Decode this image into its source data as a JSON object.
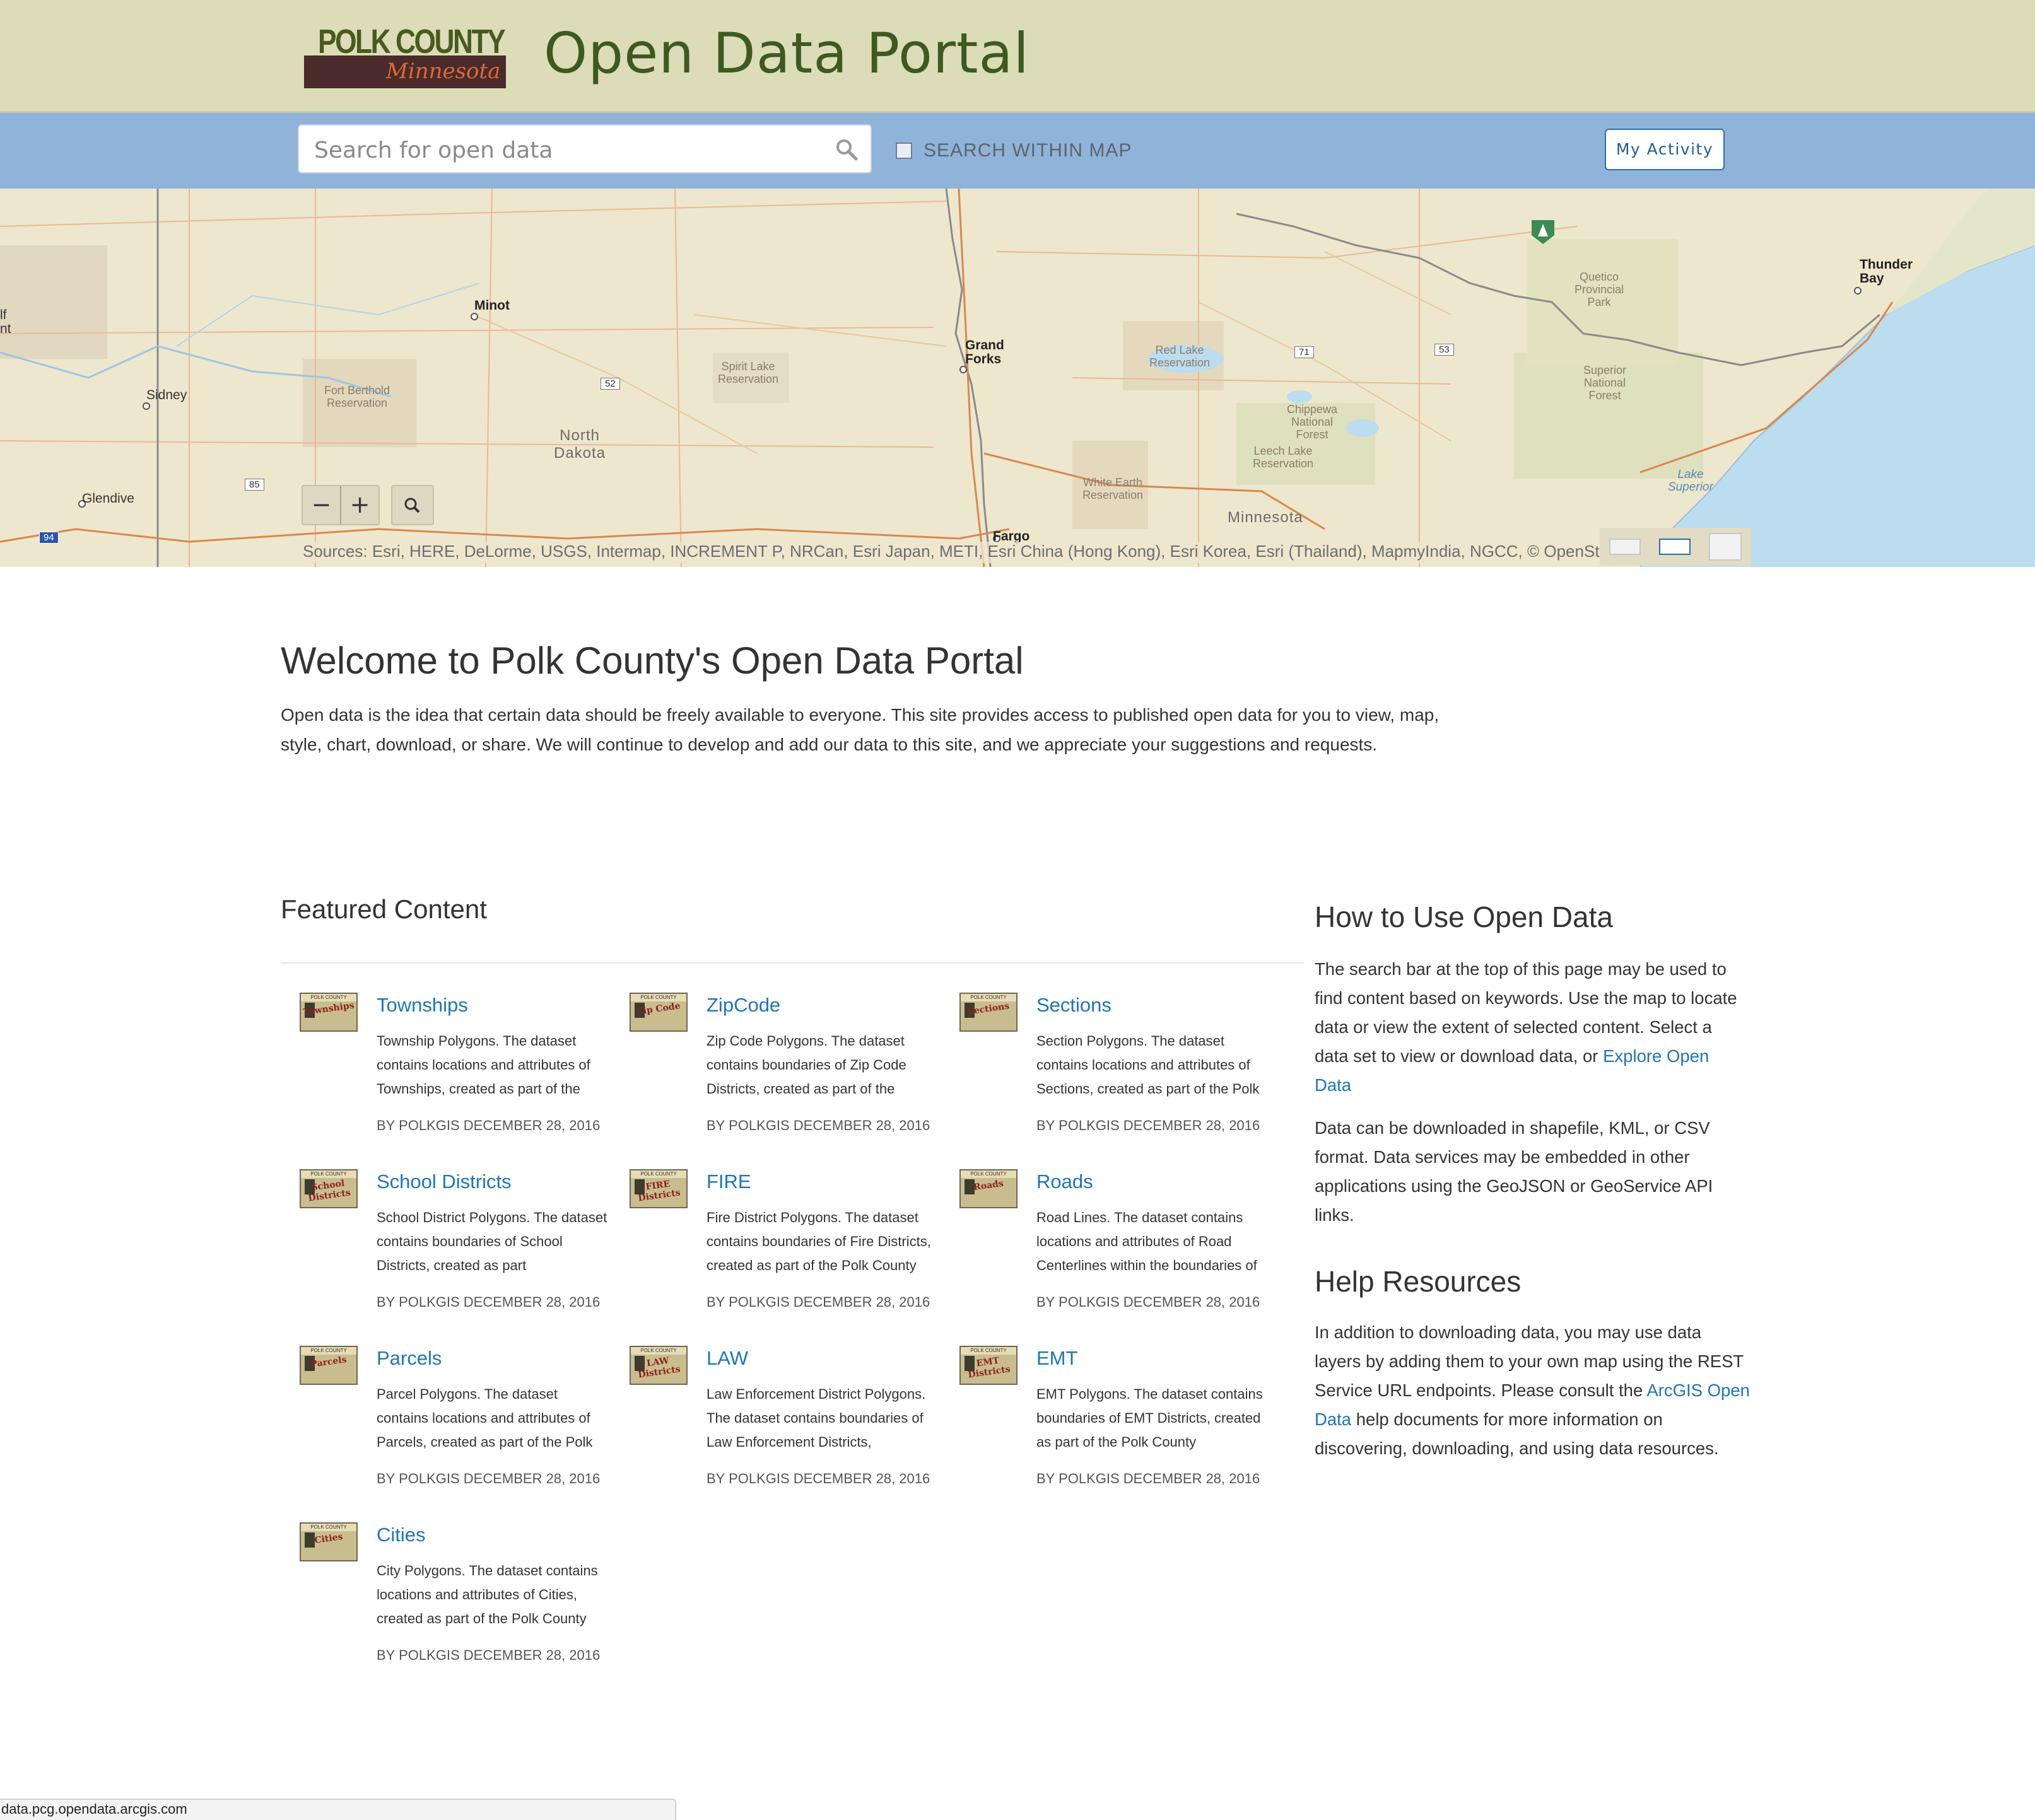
{
  "header": {
    "logo_county": "POLK COUNTY",
    "logo_state": "Minnesota",
    "title": "Open Data Portal"
  },
  "search": {
    "placeholder": "Search for open data",
    "value": "",
    "within_map_label": "SEARCH WITHIN MAP",
    "within_map_checked": false,
    "activity_button": "My Activity"
  },
  "map": {
    "labels": {
      "minot": "Minot",
      "sidney": "Sidney",
      "glendive": "Glendive",
      "grand_forks": "Grand\nForks",
      "fargo": "Fargo",
      "north_dakota": "North\nDakota",
      "minnesota": "Minnesota",
      "thunder_bay": "Thunder\nBay",
      "fort_berthold": "Fort Berthold\nReservation",
      "spirit_lake": "Spirit Lake\nReservation",
      "red_lake": "Red Lake\nReservation",
      "white_earth": "White Earth\nReservation",
      "leech_lake": "Leech Lake\nReservation",
      "chippewa": "Chippewa\nNational\nForest",
      "superior_nf": "Superior\nNational\nForest",
      "quetico": "Quetico\nProvincial\nPark",
      "lake_superior": "Lake\nSuperior",
      "edge_left": "lf\nnt",
      "hwy_52": "52",
      "hwy_85": "85",
      "hwy_71": "71",
      "hwy_53": "53",
      "hwy_94": "94"
    },
    "zoom_out": "−",
    "zoom_in": "+",
    "attribution": "Sources: Esri, HERE, DeLorme, USGS, Intermap, INCREMENT P, NRCan, Esri Japan, METI, Esri China (Hong Kong), Esri Korea, Esri (Thailand), MapmyIndia, NGCC, © OpenStre"
  },
  "welcome": {
    "title": "Welcome to Polk County's Open Data Portal",
    "text": "Open data is the idea that certain data should be freely available to everyone. This site provides access to published open data for you to view, map, style, chart, download, or share. We will continue to develop and add our data to this site, and we appreciate your suggestions and requests."
  },
  "featured": {
    "title": "Featured Content",
    "items": [
      {
        "title": "Townships",
        "thumb": "Townships",
        "desc": "Township Polygons. The dataset contains locations and attributes of Townships, created as part of the",
        "meta": "BY POLKGIS DECEMBER 28, 2016"
      },
      {
        "title": "ZipCode",
        "thumb": "Zip Code",
        "desc": "Zip Code Polygons. The dataset contains boundaries of Zip Code Districts, created as part of the",
        "meta": "BY POLKGIS DECEMBER 28, 2016"
      },
      {
        "title": "Sections",
        "thumb": "Sections",
        "desc": "Section Polygons. The dataset contains locations and attributes of Sections, created as part of the Polk",
        "meta": "BY POLKGIS DECEMBER 28, 2016"
      },
      {
        "title": "School Districts",
        "thumb": "School Districts",
        "desc": "School District Polygons. The dataset contains boundaries of School Districts, created as part",
        "meta": "BY POLKGIS DECEMBER 28, 2016"
      },
      {
        "title": "FIRE",
        "thumb": "FIRE Districts",
        "desc": "Fire District Polygons. The dataset contains boundaries of Fire Districts, created as part of the Polk County",
        "meta": "BY POLKGIS DECEMBER 28, 2016"
      },
      {
        "title": "Roads",
        "thumb": "Roads",
        "desc": "Road Lines. The dataset contains locations and attributes of Road Centerlines within the boundaries of",
        "meta": "BY POLKGIS DECEMBER 28, 2016"
      },
      {
        "title": "Parcels",
        "thumb": "Parcels",
        "desc": "Parcel Polygons. The dataset contains locations and attributes of Parcels, created as part of the Polk",
        "meta": "BY POLKGIS DECEMBER 28, 2016"
      },
      {
        "title": "LAW",
        "thumb": "LAW Districts",
        "desc": "Law Enforcement District Polygons. The dataset contains boundaries of Law Enforcement Districts,",
        "meta": "BY POLKGIS DECEMBER 28, 2016"
      },
      {
        "title": "EMT",
        "thumb": "EMT Districts",
        "desc": "EMT Polygons. The dataset contains boundaries of EMT Districts, created as part of the Polk County",
        "meta": "BY POLKGIS DECEMBER 28, 2016"
      },
      {
        "title": "Cities",
        "thumb": "Cities",
        "desc": "City Polygons. The dataset contains locations and attributes of Cities, created as part of the Polk County",
        "meta": "BY POLKGIS DECEMBER 28, 2016"
      }
    ]
  },
  "sidebar": {
    "how_title": "How to Use Open Data",
    "how_text": "The search bar at the top of this page may be used to find content based on keywords. Use the map to locate data or view the extent of selected content. Select a data set to view or download data, or",
    "explore_link": "Explore Open Data",
    "formats_text": "Data can be downloaded in shapefile, KML, or CSV format. Data services may be embedded in other applications using the GeoJSON or GeoService API links.",
    "help_title": "Help Resources",
    "help_text_before": "In addition to downloading data, you may use data layers by adding them to your own map using the REST Service URL endpoints. Please consult the",
    "arcgis_link": "ArcGIS Open Data",
    "help_text_after": "help documents for more information on discovering, downloading, and using data resources."
  },
  "status": {
    "url": "data.pcg.opendata.arcgis.com"
  },
  "colors": {
    "header_bg": "#dcdcb9",
    "title_green": "#3c5a22",
    "searchbar_bg": "#8fb3d9",
    "link_blue": "#1e75b7",
    "map_land": "#ede7cd",
    "lake_blue": "#bcdcef"
  }
}
